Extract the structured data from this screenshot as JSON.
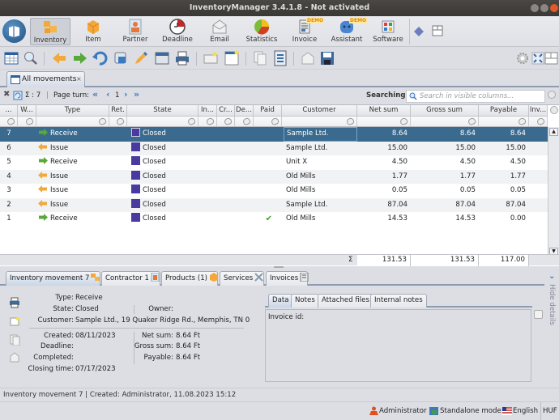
{
  "window": {
    "title": "InventoryManager 3.4.1.8 - Not activated"
  },
  "ribbon": {
    "items": [
      {
        "id": "inventory",
        "label": "Inventory",
        "icon": "boxes-icon",
        "active": true
      },
      {
        "id": "item",
        "label": "Item",
        "icon": "box-icon"
      },
      {
        "id": "partner",
        "label": "Partner",
        "icon": "partner-icon"
      },
      {
        "id": "deadline",
        "label": "Deadline",
        "icon": "clock-icon"
      },
      {
        "id": "email",
        "label": "Email",
        "icon": "envelope-icon"
      },
      {
        "id": "statistics",
        "label": "Statistics",
        "icon": "pie-chart-icon"
      },
      {
        "id": "invoice",
        "label": "Invoice",
        "icon": "invoice-icon",
        "badge": "DEMO"
      },
      {
        "id": "assistant",
        "label": "Assistant",
        "icon": "robot-icon",
        "badge": "DEMO"
      },
      {
        "id": "software",
        "label": "Software",
        "icon": "grid-apps-icon"
      }
    ]
  },
  "doc_tab": {
    "label": "All movements",
    "close": "×"
  },
  "listbar": {
    "count_label": "Σ : 7",
    "separator": "|",
    "page_turn_label": "Page turn:",
    "page": "1",
    "searching_label": "Searching:"
  },
  "search": {
    "placeholder": "Search in visible columns..."
  },
  "table": {
    "columns": [
      "...",
      "W...",
      "Type",
      "Ret.",
      "State",
      "In...",
      "Cr...",
      "De...",
      "Paid",
      "Customer",
      "Net sum",
      "Gross sum",
      "Payable",
      "Inv..."
    ],
    "rows": [
      {
        "id": "7",
        "type": "Receive",
        "state": "Closed",
        "paid": false,
        "customer": "Sample Ltd.",
        "net": "8.64",
        "gross": "8.64",
        "payable": "8.64",
        "selected": true
      },
      {
        "id": "6",
        "type": "Issue",
        "state": "Closed",
        "paid": false,
        "customer": "Sample Ltd.",
        "net": "15.00",
        "gross": "15.00",
        "payable": "15.00"
      },
      {
        "id": "5",
        "type": "Receive",
        "state": "Closed",
        "paid": false,
        "customer": "Unit X",
        "net": "4.50",
        "gross": "4.50",
        "payable": "4.50"
      },
      {
        "id": "4",
        "type": "Issue",
        "state": "Closed",
        "paid": false,
        "customer": "Old Mills",
        "net": "1.77",
        "gross": "1.77",
        "payable": "1.77"
      },
      {
        "id": "3",
        "type": "Issue",
        "state": "Closed",
        "paid": false,
        "customer": "Old Mills",
        "net": "0.05",
        "gross": "0.05",
        "payable": "0.05"
      },
      {
        "id": "2",
        "type": "Issue",
        "state": "Closed",
        "paid": false,
        "customer": "Sample Ltd.",
        "net": "87.04",
        "gross": "87.04",
        "payable": "87.04"
      },
      {
        "id": "1",
        "type": "Receive",
        "state": "Closed",
        "paid": true,
        "customer": "Old Mills",
        "net": "14.53",
        "gross": "14.53",
        "payable": "0.00"
      }
    ],
    "totals": {
      "sigma": "Σ",
      "net": "131.53",
      "gross": "131.53",
      "payable": "117.00"
    }
  },
  "bottom_tabs": [
    {
      "label": "Inventory movement 7",
      "active": true
    },
    {
      "label": "Contractor 1"
    },
    {
      "label": "Products (1)"
    },
    {
      "label": "Services"
    },
    {
      "label": "Invoices"
    }
  ],
  "detail": {
    "type_label": "Type:",
    "type_value": "Receive",
    "state_label": "State:",
    "state_value": "Closed",
    "owner_label": "Owner:",
    "owner_value": "",
    "customer_label": "Customer:",
    "customer_value": "Sample Ltd., 19 Quaker Ridge Rd., Memphis, TN 0",
    "created_label": "Created:",
    "created_value": "08/11/2023",
    "deadline_label": "Deadline:",
    "deadline_value": "",
    "completed_label": "Completed:",
    "completed_value": "",
    "closing_label": "Closing time:",
    "closing_value": "07/17/2023",
    "net_label": "Net sum:",
    "net_value": "8.64 Ft",
    "gross_label": "Gross sum:",
    "gross_value": "8.64 Ft",
    "payable_label": "Payable:",
    "payable_value": "8.64 Ft"
  },
  "detail_tabs": [
    {
      "label": "Data",
      "active": true
    },
    {
      "label": "Notes"
    },
    {
      "label": "Attached files"
    },
    {
      "label": "Internal notes"
    }
  ],
  "detail_data": {
    "invoice_id_label": "Invoice id:"
  },
  "hide_details": {
    "label": "Hide details"
  },
  "status": {
    "line": "Inventory movement 7 | Created: Administrator, 11.08.2023 15:12",
    "user": "Administrator",
    "mode": "Standalone mode",
    "language": "English",
    "currency": "HUF"
  },
  "colors": {
    "selection": "#3a6a8e",
    "state_closed": "#4a3aa0",
    "accent_tab_border": "#8c9bb0"
  }
}
